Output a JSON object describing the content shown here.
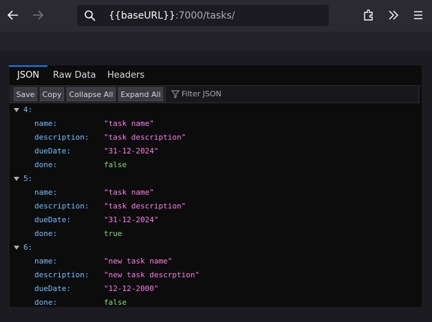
{
  "browser": {
    "url_host": "{{baseURL}}",
    "url_path": ":7000/tasks/"
  },
  "viewer": {
    "tabs": [
      {
        "label": "JSON",
        "active": true
      },
      {
        "label": "Raw Data",
        "active": false
      },
      {
        "label": "Headers",
        "active": false
      }
    ],
    "actions": {
      "save": "Save",
      "copy": "Copy",
      "collapse_all": "Collapse All",
      "expand_all": "Expand All",
      "filter_placeholder": "Filter JSON"
    },
    "items": [
      {
        "index": "4:",
        "fields": [
          {
            "key": "name:",
            "value": "\"task name\"",
            "type": "string"
          },
          {
            "key": "description:",
            "value": "\"task description\"",
            "type": "string"
          },
          {
            "key": "dueDate:",
            "value": "\"31-12-2024\"",
            "type": "string"
          },
          {
            "key": "done:",
            "value": "false",
            "type": "boolean"
          }
        ]
      },
      {
        "index": "5:",
        "fields": [
          {
            "key": "name:",
            "value": "\"task name\"",
            "type": "string"
          },
          {
            "key": "description:",
            "value": "\"task description\"",
            "type": "string"
          },
          {
            "key": "dueDate:",
            "value": "\"31-12-2024\"",
            "type": "string"
          },
          {
            "key": "done:",
            "value": "true",
            "type": "boolean"
          }
        ]
      },
      {
        "index": "6:",
        "fields": [
          {
            "key": "name:",
            "value": "\"new task name\"",
            "type": "string"
          },
          {
            "key": "description:",
            "value": "\"new task descrption\"",
            "type": "string"
          },
          {
            "key": "dueDate:",
            "value": "\"12-12-2000\"",
            "type": "string"
          },
          {
            "key": "done:",
            "value": "false",
            "type": "boolean"
          }
        ]
      }
    ]
  },
  "colors": {
    "key": "#75bfff",
    "string": "#ff7de9",
    "boolean": "#86de74",
    "accent": "#0a84ff"
  },
  "icons": [
    "back-arrow-icon",
    "forward-arrow-icon",
    "search-icon",
    "extensions-icon",
    "overflow-chevrons-icon",
    "hamburger-menu-icon",
    "filter-icon",
    "twisty-down-icon"
  ]
}
